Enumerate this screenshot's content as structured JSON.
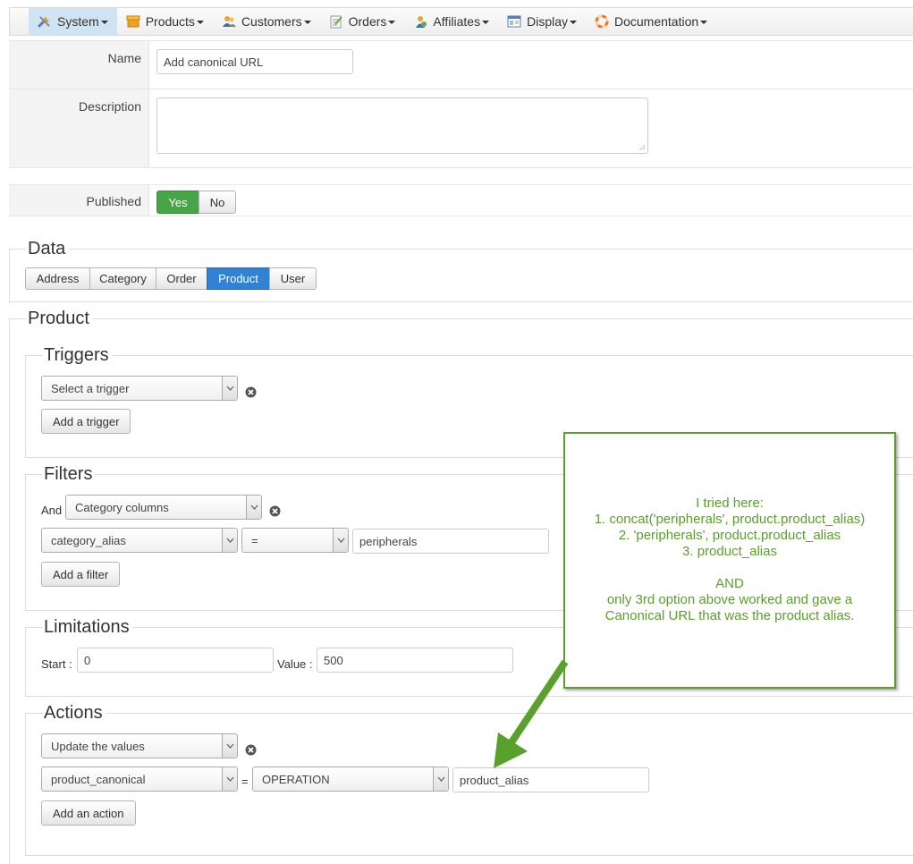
{
  "menu": {
    "items": [
      {
        "label": "System",
        "icon": "tools-icon"
      },
      {
        "label": "Products",
        "icon": "box-icon"
      },
      {
        "label": "Customers",
        "icon": "users-icon"
      },
      {
        "label": "Orders",
        "icon": "orders-icon"
      },
      {
        "label": "Affiliates",
        "icon": "affiliate-icon"
      },
      {
        "label": "Display",
        "icon": "display-icon"
      },
      {
        "label": "Documentation",
        "icon": "lifebuoy-icon"
      }
    ],
    "active": "System"
  },
  "form": {
    "name_label": "Name",
    "name_value": "Add canonical URL",
    "description_label": "Description",
    "description_value": "",
    "published_label": "Published",
    "published_yes": "Yes",
    "published_no": "No"
  },
  "data_section": {
    "title": "Data",
    "tabs": [
      "Address",
      "Category",
      "Order",
      "Product",
      "User"
    ],
    "active_tab": "Product"
  },
  "product_section": {
    "title": "Product",
    "triggers": {
      "title": "Triggers",
      "select_value": "Select a trigger",
      "add_button": "Add a trigger"
    },
    "filters": {
      "title": "Filters",
      "and_label": "And",
      "type_select": "Category columns",
      "column_select": "category_alias",
      "operator_select": "=",
      "value": "peripherals",
      "add_button": "Add a filter"
    },
    "limitations": {
      "title": "Limitations",
      "start_label": "Start :",
      "start_value": "0",
      "value_label": "Value :",
      "value_value": "500"
    },
    "actions": {
      "title": "Actions",
      "type_select": "Update the values",
      "column_select": "product_canonical",
      "equals": "=",
      "mode_select": "OPERATION",
      "value": "product_alias",
      "add_button": "Add an action"
    }
  },
  "annotation": {
    "lines": [
      "I tried here:",
      "1. concat('peripherals', product.product_alias)",
      "2. 'peripherals', product.product_alias",
      "3. product_alias",
      "",
      "AND",
      "only 3rd option above worked and gave a",
      "Canonical URL that was the product alias."
    ],
    "color": "#5aa02c"
  }
}
